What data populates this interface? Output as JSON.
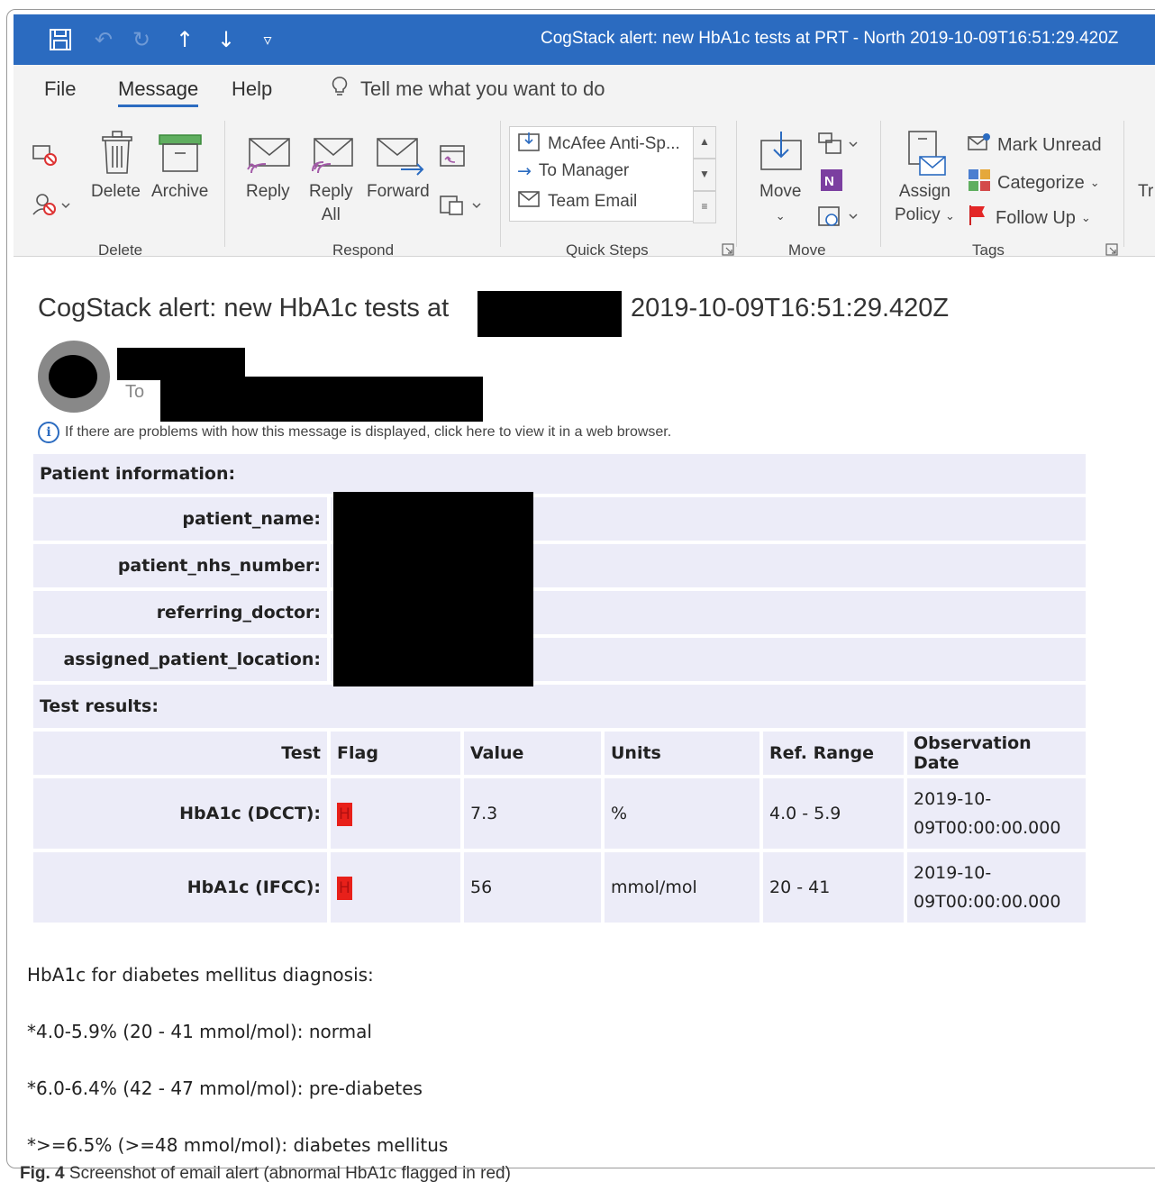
{
  "window": {
    "title": "CogStack alert: new HbA1c tests at PRT - North 2019-10-09T16:51:29.420Z"
  },
  "quick_access": {
    "customize_glyph": "▿"
  },
  "menu": {
    "tabs": [
      {
        "label": "File"
      },
      {
        "label": "Message"
      },
      {
        "label": "Help"
      }
    ],
    "tell_me": "Tell me what you want to do"
  },
  "ribbon": {
    "groups": {
      "delete": "Delete",
      "respond": "Respond",
      "quick_steps": "Quick Steps",
      "move": "Move",
      "tags": "Tags"
    },
    "delete": {
      "delete": "Delete",
      "archive": "Archive"
    },
    "respond": {
      "reply": "Reply",
      "reply_all_1": "Reply",
      "reply_all_2": "All",
      "forward": "Forward"
    },
    "quick_steps": [
      {
        "label": "McAfee Anti-Sp..."
      },
      {
        "label": "To Manager"
      },
      {
        "label": "Team Email"
      }
    ],
    "move": {
      "move": "Move"
    },
    "tags": {
      "assign_1": "Assign",
      "assign_2": "Policy",
      "mark_unread": "Mark Unread",
      "categorize": "Categorize",
      "follow_up": "Follow Up",
      "cut_off": "Tr"
    }
  },
  "message": {
    "subject_prefix": "CogStack alert: new HbA1c tests at",
    "subject_timestamp": "2019-10-09T16:51:29.420Z",
    "to_label": "To",
    "info_text": "If there are problems with how this message is displayed, click here to view it in a web browser."
  },
  "email": {
    "patient_section": "Patient information:",
    "fields": [
      {
        "label": "patient_name:"
      },
      {
        "label": "patient_nhs_number:"
      },
      {
        "label": "referring_doctor:"
      },
      {
        "label": "assigned_patient_location:"
      }
    ],
    "test_section": "Test results:",
    "columns": [
      "Test",
      "Flag",
      "Value",
      "Units",
      "Ref. Range",
      "Observation Date"
    ],
    "results": [
      {
        "test": "HbA1c (DCCT):",
        "flag": "H",
        "value": "7.3",
        "units": "%",
        "ref_range": "4.0 - 5.9",
        "date_1": "2019-10-",
        "date_2": "09T00:00:00.000"
      },
      {
        "test": "HbA1c (IFCC):",
        "flag": "H",
        "value": "56",
        "units": "mmol/mol",
        "ref_range": "20 - 41",
        "date_1": "2019-10-",
        "date_2": "09T00:00:00.000"
      }
    ],
    "notes_title": "HbA1c for diabetes mellitus diagnosis:",
    "notes": [
      "*4.0-5.9% (20 - 41 mmol/mol): normal",
      "*6.0-6.4% (42 - 47 mmol/mol): pre-diabetes",
      "*>=6.5% (>=48 mmol/mol): diabetes mellitus"
    ],
    "flag_color": "#e8201a",
    "row_color": "#ececf8"
  },
  "caption": {
    "label": "Fig. 4",
    "text": "Screenshot of email alert (abnormal HbA1c flagged in red)"
  },
  "colors": {
    "titlebar": "#2b6bc0",
    "ribbon": "#f3f3f3"
  }
}
